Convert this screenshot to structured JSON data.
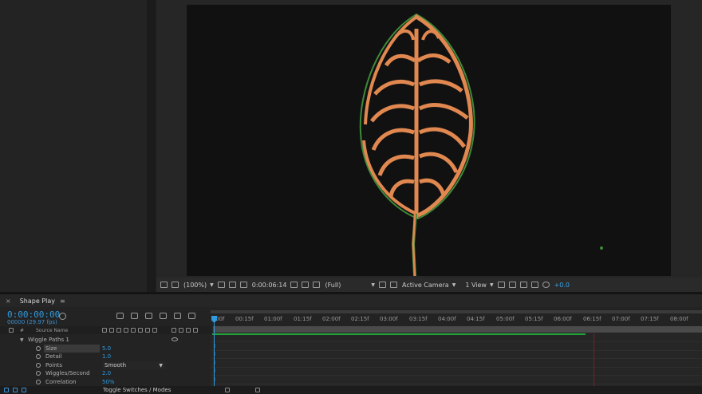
{
  "viewer": {
    "zoom": "(100%)",
    "timecode": "0:00:06:14",
    "resolution": "(Full)",
    "camera": "Active Camera",
    "views": "1 View",
    "exposure": "+0.0"
  },
  "timeline": {
    "comp_tab": "Shape Play",
    "timecode": "0:00:00:00",
    "fps": "00000 (29.97 fps)",
    "column_source_name": "Source Name",
    "column_hash": "#",
    "ruler_labels": [
      "00f",
      "00:15f",
      "01:00f",
      "01:15f",
      "02:00f",
      "02:15f",
      "03:00f",
      "03:15f",
      "04:00f",
      "04:15f",
      "05:00f",
      "05:15f",
      "06:00f",
      "06:15f",
      "07:00f",
      "07:15f",
      "08:00f"
    ],
    "group": "Wiggle Paths 1",
    "properties": [
      {
        "name": "Size",
        "value": "5.0"
      },
      {
        "name": "Detail",
        "value": "1.0"
      },
      {
        "name": "Points",
        "value": "Smooth"
      },
      {
        "name": "Wiggles/Second",
        "value": "2.0"
      },
      {
        "name": "Correlation",
        "value": "50%"
      }
    ],
    "toggle_label": "Toggle Switches / Modes"
  },
  "colors": {
    "accent_blue": "#2e9be0",
    "leaf_orange": "#e08850",
    "leaf_green": "#3e8a3a",
    "work_area_green": "#22a43a"
  }
}
